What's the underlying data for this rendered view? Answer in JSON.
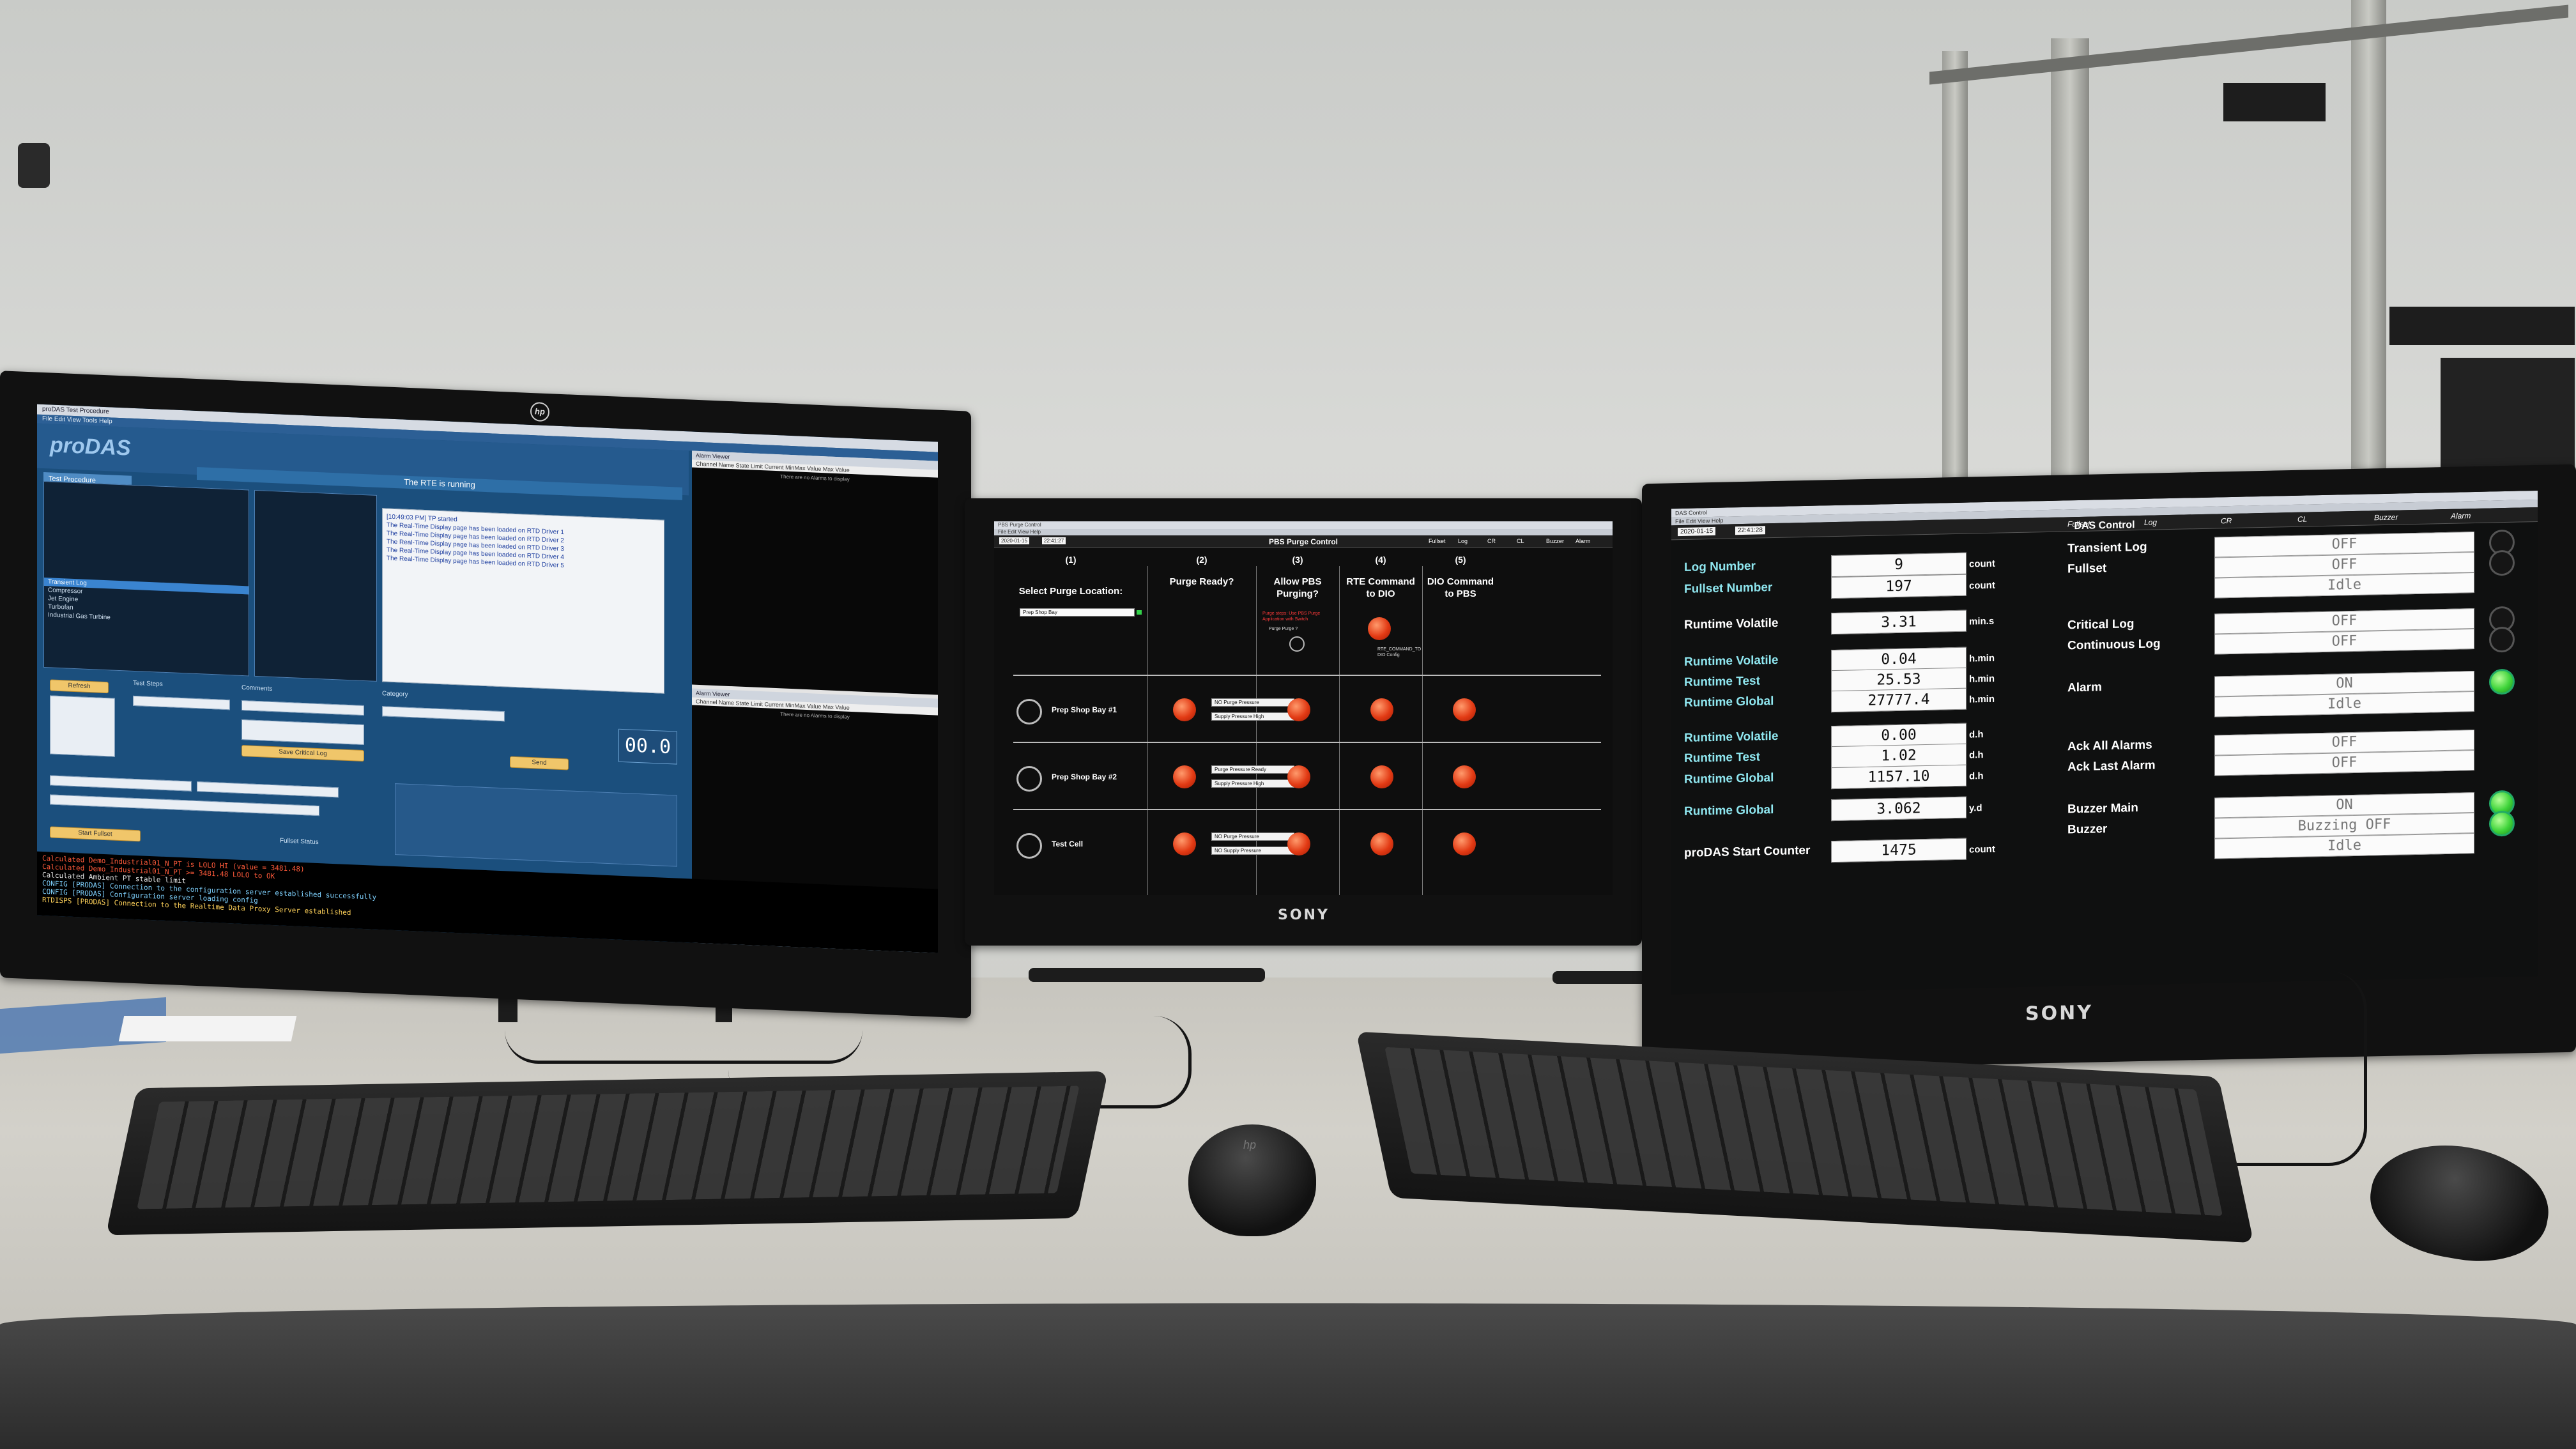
{
  "scene": {
    "left_monitor_brand": "hp",
    "center_monitor_brand": "SONY",
    "right_monitor_brand": "SONY",
    "mouse_logo": "hp",
    "colors": {
      "left_app_blue": "#1b4f7d",
      "indicator_red": "#e23a14",
      "indicator_green": "#3fd43a",
      "label_cyan": "#8fe6ef"
    }
  },
  "left_app": {
    "logo": "proDAS",
    "banner": "The RTE is running",
    "tab": "Test Procedure",
    "clock": "00.0",
    "list_items": [
      "Transient Log",
      "Compressor",
      "Jet Engine",
      "Turbofan",
      "Industrial Gas Turbine"
    ],
    "selected_item": "Transient Log",
    "messages": [
      "[10:49:03 PM] TP started",
      "The Real-Time Display page has been loaded on RTD Driver 1",
      "The Real-Time Display page has been loaded on RTD Driver 2",
      "The Real-Time Display page has been loaded on RTD Driver 3",
      "The Real-Time Display page has been loaded on RTD Driver 4",
      "The Real-Time Display page has been loaded on RTD Driver 5"
    ],
    "buttons": {
      "save_critical_log": "Save Critical Log",
      "start_fullset": "Start Fullset",
      "refresh": "Refresh",
      "send": "Send"
    },
    "labels": {
      "test_steps": "Test Steps",
      "comments": "Comments",
      "category": "Category",
      "fullset_status": "Fullset Status"
    },
    "log_lines": [
      {
        "text": "Calculated Demo_Industrial01_N_PT is LOLO HI (value = 3481.48)",
        "color": "#ff5a3a"
      },
      {
        "text": "Calculated Demo_Industrial01_N_PT >= 3481.48 LOLO to OK",
        "color": "#ff5a3a"
      },
      {
        "text": "Calculated Ambient PT stable limit",
        "color": "#e6e6e6"
      },
      {
        "text": "CONFIG [PRODAS] Connection to the configuration server established successfully",
        "color": "#7fd2ff"
      },
      {
        "text": "CONFIG [PRODAS] Configuration server loading config",
        "color": "#7fd2ff"
      },
      {
        "text": "RTDISPS [PRODAS] Connection to the Realtime Data Proxy Server established",
        "color": "#ffd25a"
      }
    ],
    "mini_window_title": "Channel Name  State  Limit  Current  MinMax Value  Max Value",
    "mini_window_note": "There are no Alarms to display"
  },
  "pbs": {
    "window_title": "PBS Purge Control",
    "time_a": "2020-01-15",
    "time_b": "22:41:27",
    "status_items": [
      "Fullset",
      "Log",
      "CR",
      "CL",
      "Buzzer",
      "Alarm"
    ],
    "columns": [
      {
        "num": "(1)",
        "head": "Select Purge Location:"
      },
      {
        "num": "(2)",
        "head": "Purge Ready?"
      },
      {
        "num": "(3)",
        "head": "Allow PBS Purging?"
      },
      {
        "num": "(4)",
        "head": "RTE Command to DIO"
      },
      {
        "num": "(5)",
        "head": "DIO Command to PBS"
      }
    ],
    "location_field": "Prep Shop Bay",
    "allow_note": "Purge steps: Use PBS Purge Application with Switch",
    "allow_check": "Purge Purge ?",
    "rte_note": "RTE_COMMAND_TO DIO Config",
    "rows": [
      {
        "label": "Prep Shop Bay #1",
        "tags": [
          "NO Purge Pressure",
          "Supply Pressure High"
        ]
      },
      {
        "label": "Prep Shop Bay #2",
        "tags": [
          "Purge Pressure Ready",
          "Supply Pressure High"
        ]
      },
      {
        "label": "Test Cell",
        "tags": [
          "NO Purge Pressure",
          "NO Supply Pressure"
        ]
      }
    ]
  },
  "das": {
    "window_title": "DAS Control",
    "time_a": "2020-01-15",
    "time_b": "22:41:28",
    "status_items": [
      "Fullset",
      "Log",
      "CR",
      "CL",
      "Buzzer",
      "Alarm"
    ],
    "counters": [
      {
        "label": "Log Number",
        "value": "9",
        "unit": "count",
        "color": "cyan"
      },
      {
        "label": "Fullset Number",
        "value": "197",
        "unit": "count",
        "color": "cyan"
      },
      {
        "label": "Runtime Volatile",
        "value": "3.31",
        "unit": "min.s",
        "color": "white"
      },
      {
        "label": "Runtime Volatile",
        "value": "0.04",
        "unit": "h.min",
        "color": "cyan"
      },
      {
        "label": "Runtime Test",
        "value": "25.53",
        "unit": "h.min",
        "color": "cyan"
      },
      {
        "label": "Runtime Global",
        "value": "27777.4",
        "unit": "h.min",
        "color": "cyan"
      },
      {
        "label": "Runtime Volatile",
        "value": "0.00",
        "unit": "d.h",
        "color": "cyan"
      },
      {
        "label": "Runtime Test",
        "value": "1.02",
        "unit": "d.h",
        "color": "cyan"
      },
      {
        "label": "Runtime Global",
        "value": "1157.10",
        "unit": "d.h",
        "color": "cyan"
      },
      {
        "label": "Runtime Global",
        "value": "3.062",
        "unit": "y.d",
        "color": "cyan"
      },
      {
        "label": "proDAS Start Counter",
        "value": "1475",
        "unit": "count",
        "color": "white"
      }
    ],
    "controls": [
      {
        "label": "Transient Log",
        "state": "OFF",
        "on": false
      },
      {
        "label": "Fullset",
        "state": "OFF",
        "on": false
      },
      {
        "label": "",
        "state": "Idle",
        "on": null
      },
      {
        "label": "Critical Log",
        "state": "OFF",
        "on": false
      },
      {
        "label": "Continuous Log",
        "state": "OFF",
        "on": false
      },
      {
        "label": "Alarm",
        "state": "ON",
        "on": true
      },
      {
        "label": "",
        "state": "Idle",
        "on": null
      },
      {
        "label": "Ack All Alarms",
        "state": "OFF",
        "on": null
      },
      {
        "label": "Ack Last Alarm",
        "state": "OFF",
        "on": null
      },
      {
        "label": "Buzzer Main",
        "state": "ON",
        "on": true
      },
      {
        "label": "Buzzer",
        "state": "Buzzing OFF",
        "on": true
      },
      {
        "label": "",
        "state": "Idle",
        "on": null
      }
    ]
  }
}
